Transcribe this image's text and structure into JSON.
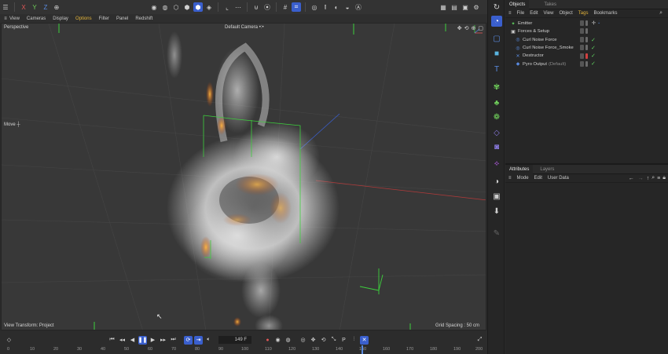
{
  "top_toolbar": {
    "axis_x": "X",
    "axis_y": "Y",
    "axis_z": "Z"
  },
  "menu": {
    "items": [
      "View",
      "Cameras",
      "Display",
      "Options",
      "Filter",
      "Panel",
      "Redshift"
    ],
    "active": "Options"
  },
  "viewport": {
    "view_name": "Perspective",
    "camera": "Default Camera",
    "camera_suffix": "•:•",
    "tool": "Move",
    "transform_label": "View Transform: Project",
    "grid_spacing": "Grid Spacing : 50 cm"
  },
  "timeline": {
    "current_frame": "149 F",
    "ruler": [
      "0",
      "10",
      "20",
      "30",
      "40",
      "50",
      "60",
      "70",
      "80",
      "90",
      "100",
      "110",
      "120",
      "130",
      "140",
      "150",
      "160",
      "170",
      "180",
      "190",
      "200"
    ]
  },
  "objects_panel": {
    "tabs": [
      "Objects",
      "Takes"
    ],
    "menu": [
      "File",
      "Edit",
      "View",
      "Object",
      "Tags",
      "Bookmarks"
    ],
    "active_menu": "Tags",
    "rows": [
      {
        "name": "Emitter",
        "suffix": "",
        "icon": "emitter-icon",
        "glyph": "✦",
        "color": "#5fd35f",
        "indent": 0,
        "checked": false
      },
      {
        "name": "Forces & Setup",
        "suffix": "",
        "icon": "null-group-icon",
        "glyph": "▣",
        "color": "#cfcfcf",
        "indent": 0,
        "checked": false
      },
      {
        "name": "Curl Noise Force",
        "suffix": "",
        "icon": "force-icon",
        "glyph": "◎",
        "color": "#5a8be0",
        "indent": 1,
        "checked": true
      },
      {
        "name": "Curl Noise Force_Smoke",
        "suffix": "",
        "icon": "force-icon",
        "glyph": "◎",
        "color": "#5a8be0",
        "indent": 1,
        "checked": true
      },
      {
        "name": "Destructor",
        "suffix": "",
        "icon": "destructor-icon",
        "glyph": "✕",
        "color": "#5a8be0",
        "indent": 1,
        "checked": true
      },
      {
        "name": "Pyro Output",
        "suffix": "(Default)",
        "icon": "pyro-output-icon",
        "glyph": "◆",
        "color": "#5a8be0",
        "indent": 1,
        "checked": true
      }
    ]
  },
  "attributes_panel": {
    "tabs": [
      "Attributes",
      "Layers"
    ],
    "menu": [
      "Mode",
      "Edit",
      "User Data"
    ]
  }
}
